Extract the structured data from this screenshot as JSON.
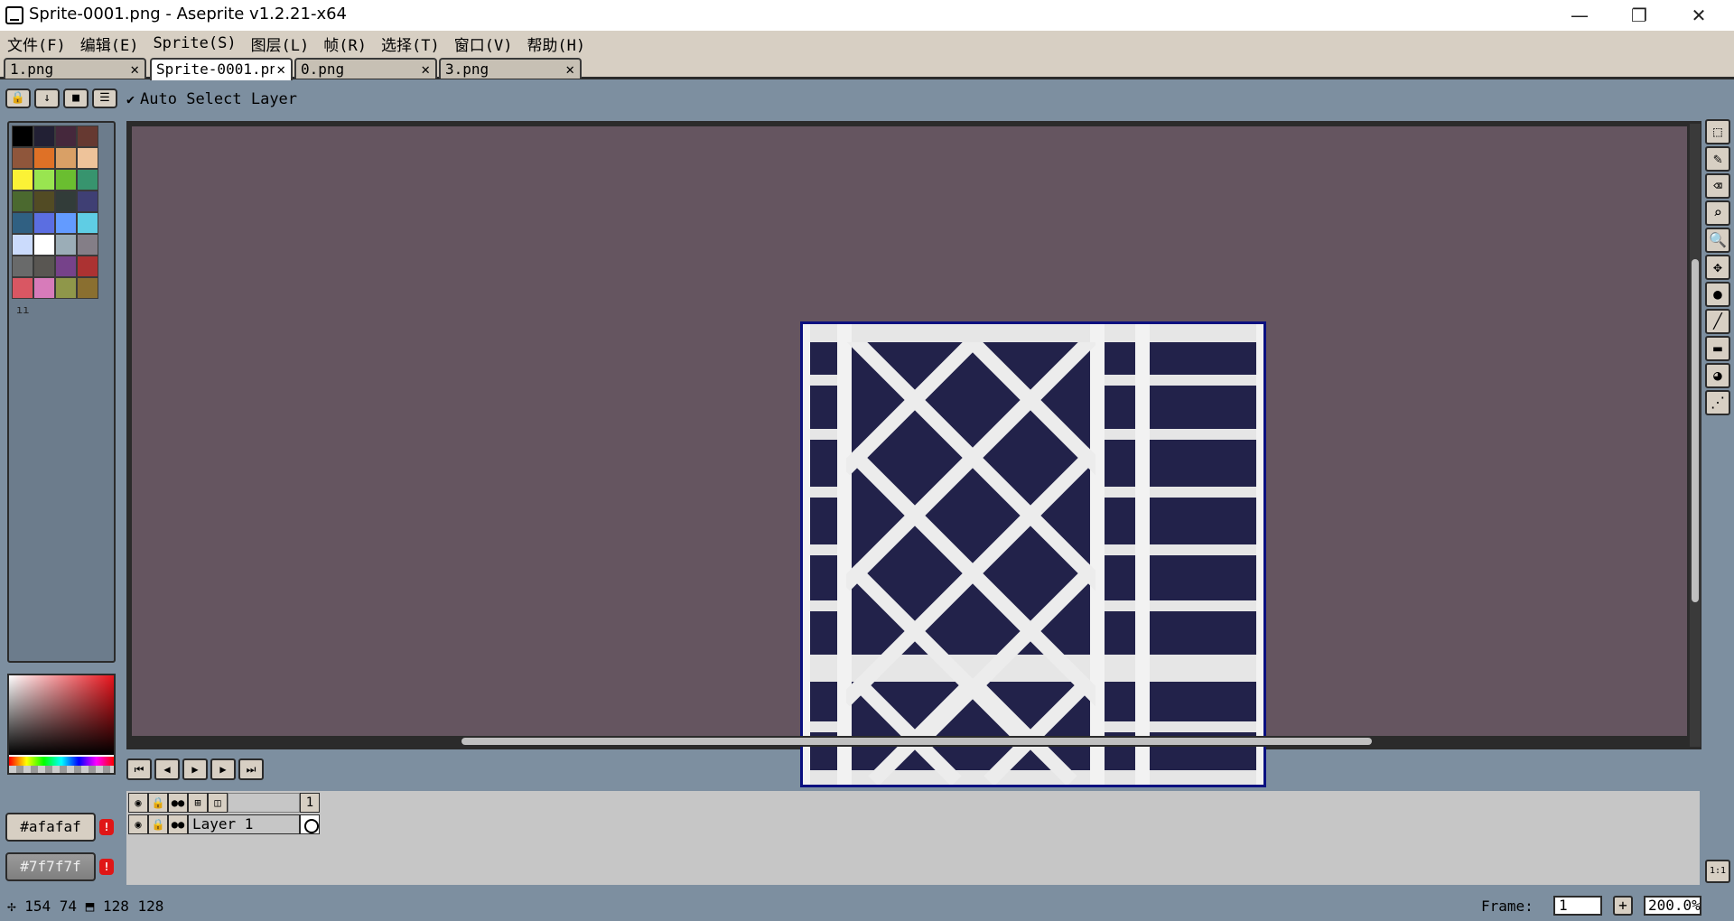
{
  "window": {
    "title": "Sprite-0001.png - Aseprite v1.2.21-x64",
    "minimize_glyph": "—",
    "restore_glyph": "❐",
    "close_glyph": "✕"
  },
  "menu": [
    "文件(F)",
    "编辑(E)",
    "Sprite(S)",
    "图层(L)",
    "帧(R)",
    "选择(T)",
    "窗口(V)",
    "帮助(H)"
  ],
  "tabs": [
    {
      "label": "1.png",
      "active": false
    },
    {
      "label": "Sprite-0001.png",
      "active": true
    },
    {
      "label": "0.png",
      "active": false
    },
    {
      "label": "3.png",
      "active": false
    }
  ],
  "tab_close_glyph": "✕",
  "palette_tools": [
    {
      "icon": "lock-icon",
      "glyph": "🔒"
    },
    {
      "icon": "arrow-down-icon",
      "glyph": "↓"
    },
    {
      "icon": "stop-icon",
      "glyph": "■"
    },
    {
      "icon": "menu-icon",
      "glyph": "☰"
    }
  ],
  "palette": [
    "#000000",
    "#222034",
    "#45283c",
    "#663931",
    "#8f563b",
    "#df7126",
    "#d9a066",
    "#eec39a",
    "#fbf236",
    "#99e550",
    "#6abe30",
    "#37946e",
    "#4b692f",
    "#524b24",
    "#323c39",
    "#3f3f74",
    "#306082",
    "#5b6ee1",
    "#639bff",
    "#5fcde4",
    "#cbdbfc",
    "#ffffff",
    "#9badb7",
    "#847e87",
    "#696a6a",
    "#595652",
    "#76428a",
    "#ac3232",
    "#d95763",
    "#d77bba",
    "#8f974a",
    "#8a6f30"
  ],
  "palette_handle": "ıı",
  "context": {
    "check_glyph": "✔",
    "auto_select_label": "Auto Select Layer"
  },
  "colors": {
    "fg_label": "#afafaf",
    "bg_label": "#7f7f7f",
    "warn_glyph": "!"
  },
  "right_tools": [
    {
      "icon": "marquee-icon",
      "glyph": "⬚"
    },
    {
      "icon": "pencil-icon",
      "glyph": "✎"
    },
    {
      "icon": "eraser-icon",
      "glyph": "⌫"
    },
    {
      "icon": "eyedropper-icon",
      "glyph": "⌕"
    },
    {
      "icon": "zoom-icon",
      "glyph": "🔍"
    },
    {
      "icon": "move-icon",
      "glyph": "✥"
    },
    {
      "icon": "bucket-icon",
      "glyph": "●"
    },
    {
      "icon": "line-icon",
      "glyph": "╱"
    },
    {
      "icon": "rectangle-icon",
      "glyph": "▬"
    },
    {
      "icon": "curve-icon",
      "glyph": "◕"
    },
    {
      "icon": "spray-icon",
      "glyph": "⋰"
    }
  ],
  "timeline": {
    "controls": [
      {
        "icon": "first-frame-icon",
        "glyph": "⏮"
      },
      {
        "icon": "prev-frame-icon",
        "glyph": "◀"
      },
      {
        "icon": "play-icon",
        "glyph": "▶"
      },
      {
        "icon": "next-frame-icon",
        "glyph": "▶"
      },
      {
        "icon": "last-frame-icon",
        "glyph": "⏭"
      }
    ],
    "header_icons": [
      {
        "icon": "eye-icon",
        "glyph": "◉"
      },
      {
        "icon": "lock-icon",
        "glyph": "🔒"
      },
      {
        "icon": "continuous-icon",
        "glyph": "●●"
      },
      {
        "icon": "onion-icon",
        "glyph": "⊞"
      },
      {
        "icon": "link-icon",
        "glyph": "◫"
      }
    ],
    "frame_number": "1",
    "layer_icons": [
      {
        "icon": "eye-icon",
        "glyph": "◉"
      },
      {
        "icon": "lock-icon",
        "glyph": "🔒"
      },
      {
        "icon": "continuous-icon",
        "glyph": "●●"
      }
    ],
    "layer_name": "Layer 1",
    "zoom_1to1": "1:1"
  },
  "status": {
    "position": "✢ 154 74 ⬒ 128  128",
    "frame_label": "Frame:",
    "frame_value": "1",
    "frame_plus": "+",
    "zoom": "200.0%"
  }
}
